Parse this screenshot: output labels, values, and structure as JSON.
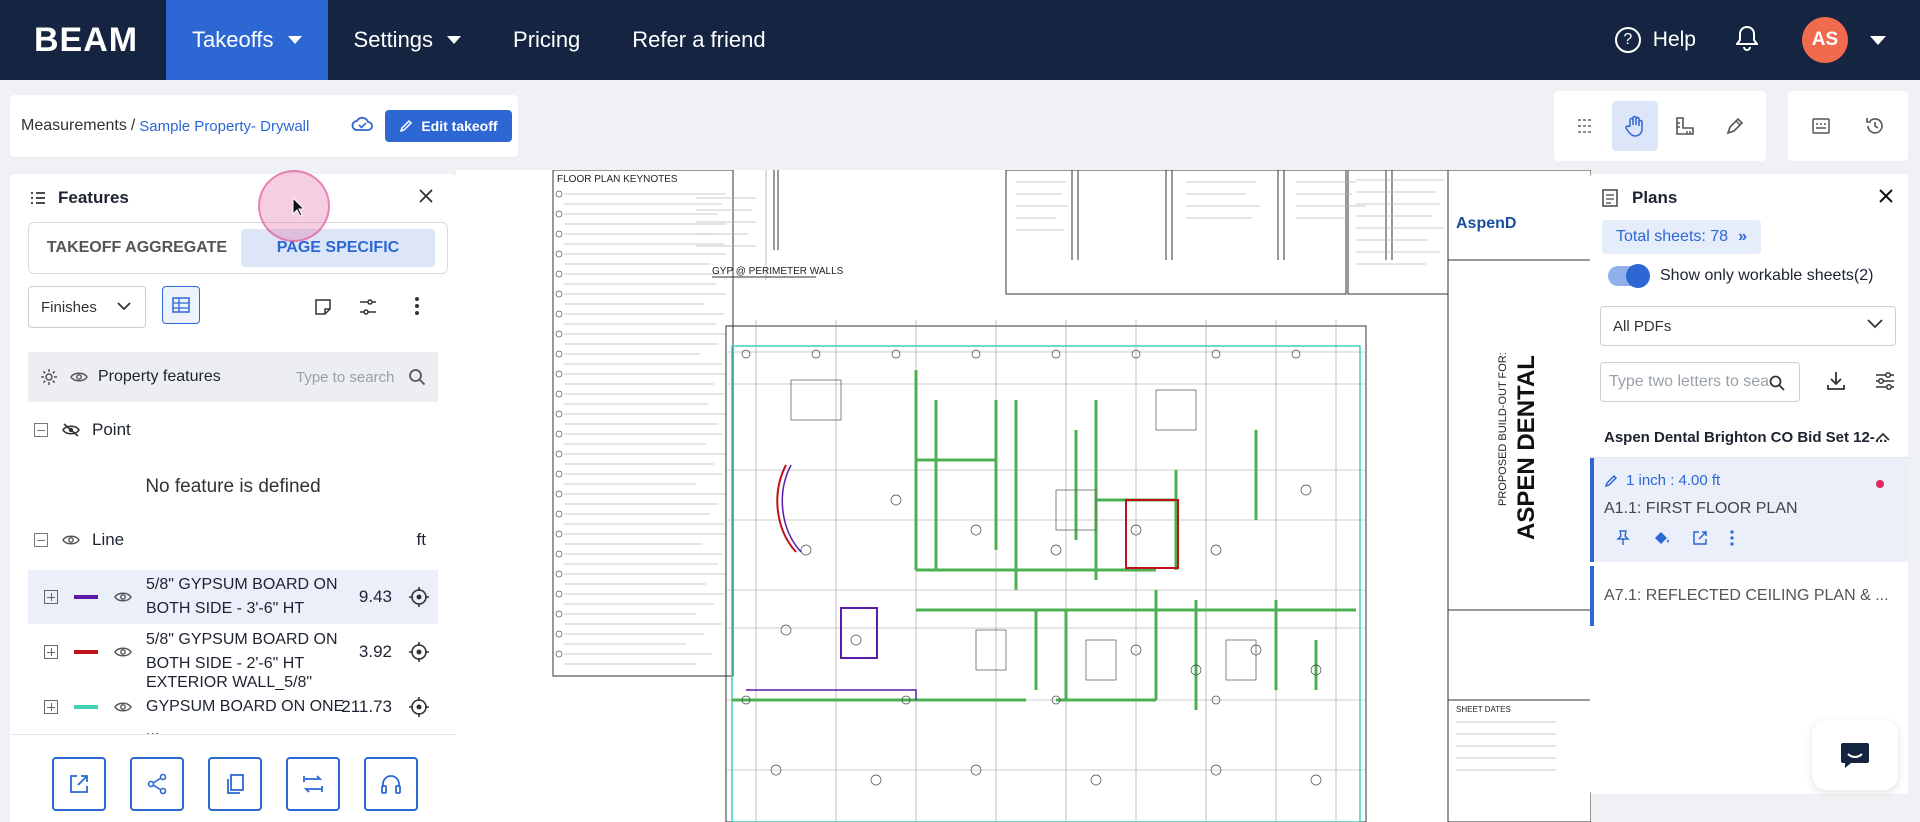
{
  "nav": {
    "logo": "BEAM",
    "items": [
      {
        "label": "Takeoffs",
        "active": true,
        "dropdown": true
      },
      {
        "label": "Settings",
        "active": false,
        "dropdown": true
      },
      {
        "label": "Pricing",
        "active": false,
        "dropdown": false
      },
      {
        "label": "Refer a friend",
        "active": false,
        "dropdown": false
      }
    ],
    "help_label": "Help",
    "avatar_initials": "AS",
    "help_symbol": "?"
  },
  "breadcrumb": {
    "root": "Measurements",
    "separator": "/",
    "current": "Sample Property- Drywall",
    "edit_label": "Edit takeoff"
  },
  "features": {
    "title": "Features",
    "tabs": [
      "TAKEOFF AGGREGATE",
      "PAGE SPECIFIC"
    ],
    "active_tab": "PAGE SPECIFIC",
    "filter_value": "Finishes",
    "property_label": "Property features",
    "search_placeholder": "Type to search",
    "point_group": "Point",
    "empty_text": "No feature is defined",
    "line_group": "Line",
    "line_unit": "ft",
    "rows": [
      {
        "name": "5/8\" GYPSUM BOARD ON BOTH SIDE - 3'-6\" HT",
        "value": "9.43",
        "color": "#5b1aa8",
        "selected": true
      },
      {
        "name": "5/8\" GYPSUM BOARD ON BOTH SIDE - 2'-6\" HT",
        "value": "3.92",
        "color": "#c0111b",
        "selected": false
      },
      {
        "name": "EXTERIOR WALL_5/8\" GYPSUM BOARD ON ONE ...",
        "value": "211.73",
        "color": "#3fd0b6",
        "selected": false
      }
    ]
  },
  "drawing": {
    "keynotes_title": "FLOOR PLAN KEYNOTES",
    "detail_title": "GYP @ PERIMETER WALLS",
    "title_block": {
      "brand": "AspenD",
      "proposed": "PROPOSED BUILD-OUT FOR:",
      "client": "ASPEN DENTAL",
      "sheet_dates": "SHEET DATES"
    }
  },
  "plans": {
    "title": "Plans",
    "total_label": "Total sheets: 78",
    "toggle_label": "Show only workable sheets(2)",
    "pdf_filter": "All PDFs",
    "search_placeholder": "Type two letters to search",
    "set_name": "Aspen Dental Brighton CO Bid Set 12-...",
    "sheets": [
      {
        "scale": "1 inch : 4.00 ft",
        "name": "A1.1: FIRST FLOOR PLAN",
        "selected": true
      },
      {
        "scale": "",
        "name": "A7.1: REFLECTED CEILING PLAN & ...",
        "selected": false
      }
    ]
  },
  "colors": {
    "nav_bg": "#152541",
    "accent": "#2d67d3",
    "avatar": "#f06a4d",
    "wall_green": "#4caf50",
    "plan_cyan": "#3fd0b6"
  }
}
